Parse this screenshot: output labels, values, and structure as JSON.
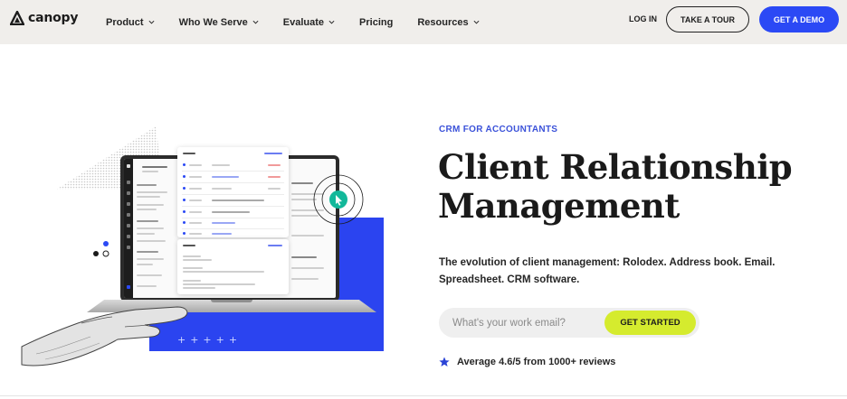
{
  "nav": {
    "logo_text": "canopy",
    "menu": [
      {
        "label": "Product",
        "has_dropdown": true
      },
      {
        "label": "Who We Serve",
        "has_dropdown": true
      },
      {
        "label": "Evaluate",
        "has_dropdown": true
      },
      {
        "label": "Pricing",
        "has_dropdown": false
      },
      {
        "label": "Resources",
        "has_dropdown": true
      }
    ],
    "login": "LOG IN",
    "tour": "TAKE A TOUR",
    "demo": "GET A DEMO"
  },
  "hero": {
    "eyebrow": "CRM FOR ACCOUNTANTS",
    "headline_line1": "Client Relationship",
    "headline_line2": "Management",
    "description": "The evolution of client management: Rolodex. Address book. Email. Spreadsheet. CRM software.",
    "email_placeholder": "What's your work email?",
    "cta": "GET STARTED",
    "rating": "Average 4.6/5 from 1000+ reviews"
  },
  "colors": {
    "nav_bg": "#f0eeeb",
    "brand_blue": "#2b49f5",
    "cta_lime": "#d5eb2e",
    "eyebrow_blue": "#3b52d9"
  },
  "icons": {
    "logo": "canopy-logo-icon",
    "dropdown": "chevron-down-icon",
    "rating": "star-icon"
  }
}
